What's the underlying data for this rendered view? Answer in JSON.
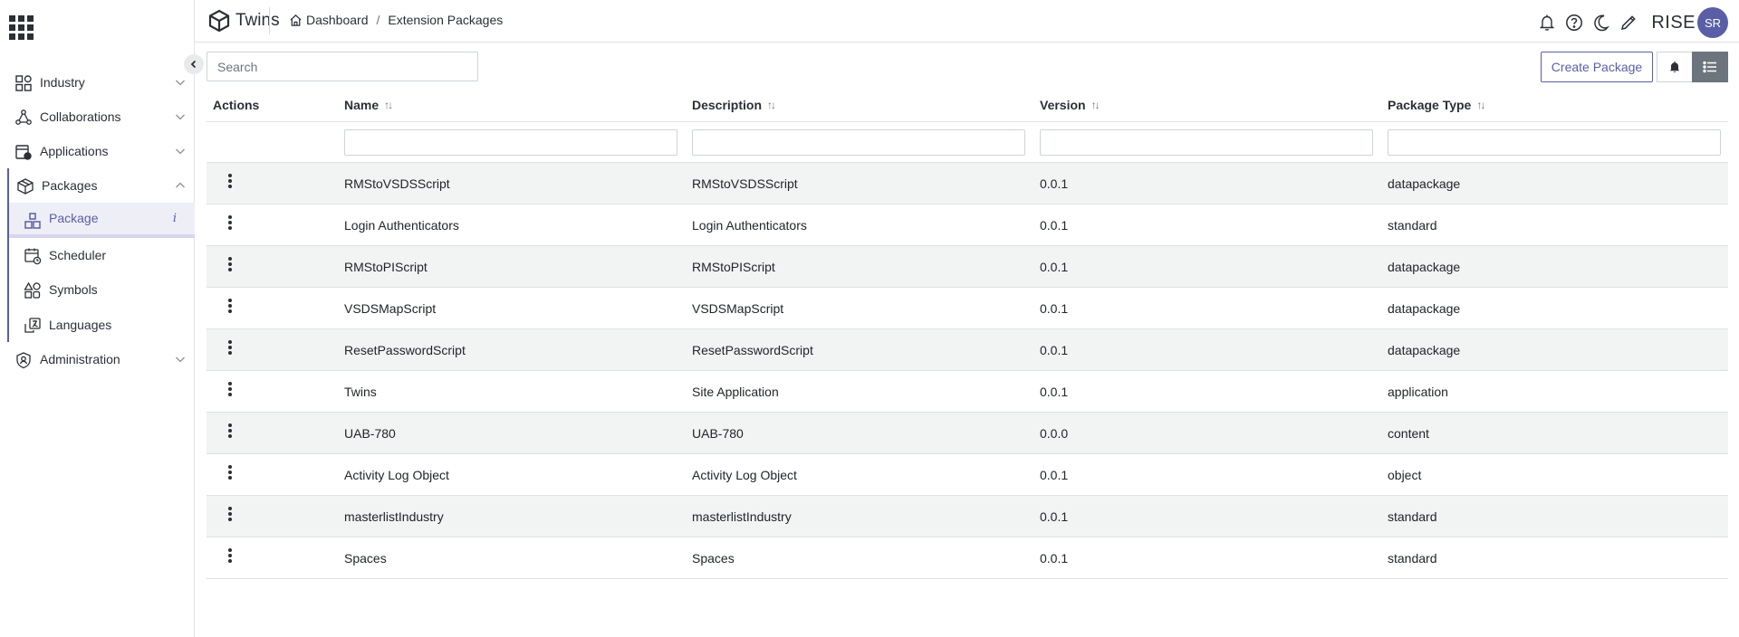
{
  "sidebar": {
    "items": [
      {
        "label": "Industry",
        "icon": "dashboard-grid-icon"
      },
      {
        "label": "Collaborations",
        "icon": "collaboration-network-icon"
      },
      {
        "label": "Applications",
        "icon": "applications-icon"
      },
      {
        "label": "Packages",
        "icon": "package-box-icon"
      },
      {
        "label": "Administration",
        "icon": "shield-icon"
      }
    ],
    "sub_items": [
      {
        "label": "Package",
        "icon": "package-boxes-icon",
        "active": true,
        "info": "i"
      },
      {
        "label": "Scheduler",
        "icon": "calendar-clock-icon"
      },
      {
        "label": "Symbols",
        "icon": "shapes-icon"
      },
      {
        "label": "Languages",
        "icon": "translate-icon"
      }
    ]
  },
  "header": {
    "app_name": "Twins",
    "breadcrumb": {
      "home": "Dashboard",
      "separator": "/",
      "current": "Extension Packages"
    },
    "brand": "RISE",
    "avatar_initials": "SR"
  },
  "toolbar": {
    "search_placeholder": "Search",
    "create_label": "Create Package"
  },
  "table": {
    "columns": {
      "actions": "Actions",
      "name": "Name",
      "description": "Description",
      "version": "Version",
      "package_type": "Package Type"
    },
    "sort_glyph": "↑↓",
    "rows": [
      {
        "name": "RMStoVSDSScript",
        "description": "RMStoVSDSScript",
        "version": "0.0.1",
        "type": "datapackage"
      },
      {
        "name": "Login Authenticators",
        "description": "Login Authenticators",
        "version": "0.0.1",
        "type": "standard"
      },
      {
        "name": "RMStoPIScript",
        "description": "RMStoPIScript",
        "version": "0.0.1",
        "type": "datapackage"
      },
      {
        "name": "VSDSMapScript",
        "description": "VSDSMapScript",
        "version": "0.0.1",
        "type": "datapackage"
      },
      {
        "name": "ResetPasswordScript",
        "description": "ResetPasswordScript",
        "version": "0.0.1",
        "type": "datapackage"
      },
      {
        "name": "Twins",
        "description": "Site Application",
        "version": "0.0.1",
        "type": "application"
      },
      {
        "name": "UAB-780",
        "description": "UAB-780",
        "version": "0.0.0",
        "type": "content"
      },
      {
        "name": "Activity Log Object",
        "description": "Activity Log Object",
        "version": "0.0.1",
        "type": "object"
      },
      {
        "name": "masterlistIndustry",
        "description": "masterlistIndustry",
        "version": "0.0.1",
        "type": "standard"
      },
      {
        "name": "Spaces",
        "description": "Spaces",
        "version": "0.0.1",
        "type": "standard"
      }
    ]
  },
  "colors": {
    "accent": "#5a5ea6",
    "row_stripe": "#f2f3f3",
    "active_toggle": "#6c757d"
  }
}
